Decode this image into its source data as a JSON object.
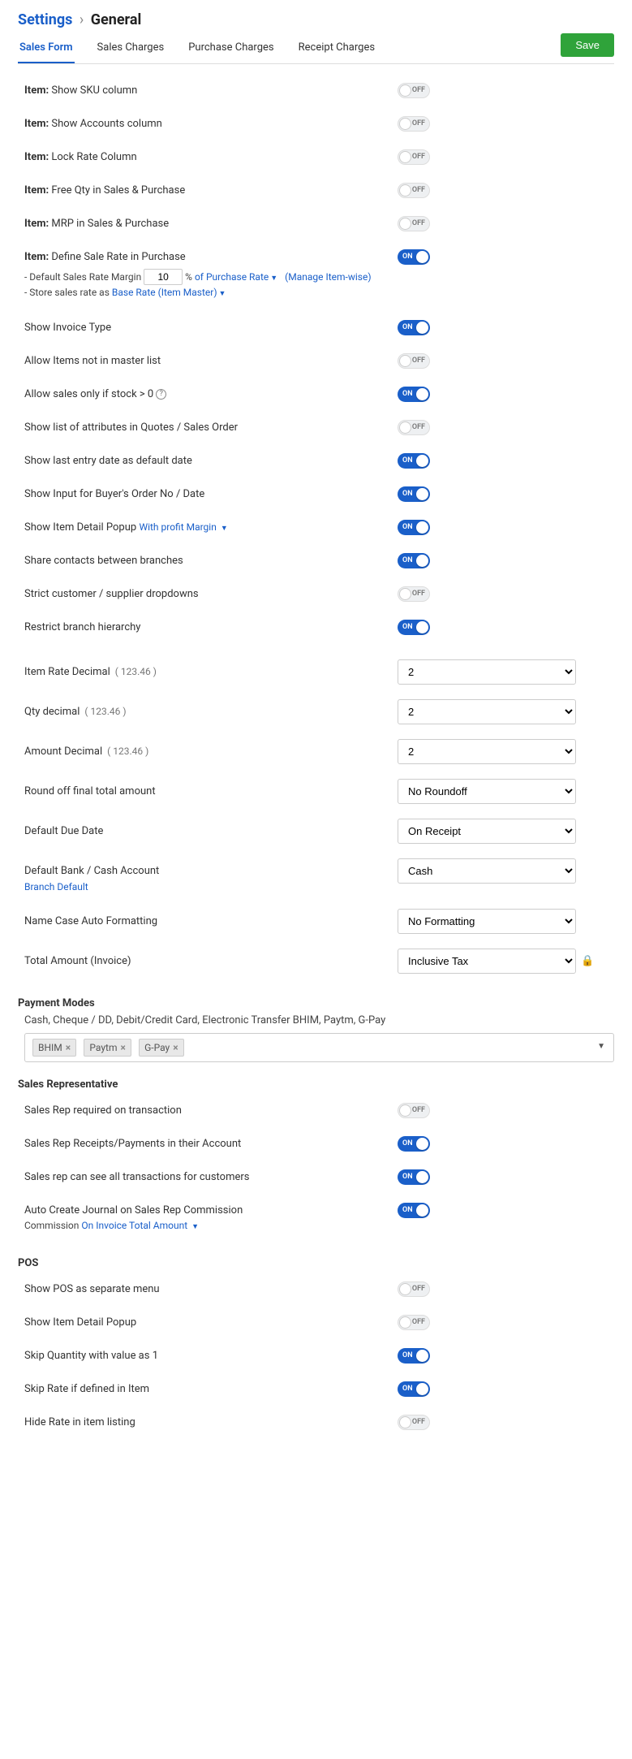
{
  "breadcrumb": {
    "parent": "Settings",
    "sep": "›",
    "current": "General"
  },
  "tabs": {
    "t0": "Sales Form",
    "t1": "Sales Charges",
    "t2": "Purchase Charges",
    "t3": "Receipt Charges"
  },
  "save": "Save",
  "item_prefix": "Item:",
  "toggles": {
    "sku": {
      "label": "Show SKU column",
      "state": "OFF"
    },
    "accounts": {
      "label": "Show Accounts column",
      "state": "OFF"
    },
    "lockrate": {
      "label": "Lock Rate Column",
      "state": "OFF"
    },
    "freeqty": {
      "label": "Free Qty in Sales & Purchase",
      "state": "OFF"
    },
    "mrp": {
      "label": "MRP in Sales & Purchase",
      "state": "OFF"
    },
    "defsale": {
      "label": "Define Sale Rate in Purchase",
      "state": "ON"
    },
    "invtype": {
      "label": "Show Invoice Type",
      "state": "ON"
    },
    "notmaster": {
      "label": "Allow Items not in master list",
      "state": "OFF"
    },
    "stockgt0": {
      "label": "Allow sales only if stock > 0",
      "state": "ON"
    },
    "attrlist": {
      "label": "Show list of attributes in Quotes / Sales Order",
      "state": "OFF"
    },
    "lastdate": {
      "label": "Show last entry date as default date",
      "state": "ON"
    },
    "buyerord": {
      "label": "Show Input for Buyer's Order No / Date",
      "state": "ON"
    },
    "itempopup": {
      "label": "Show Item Detail Popup",
      "state": "ON"
    },
    "sharecont": {
      "label": "Share contacts between branches",
      "state": "ON"
    },
    "strictdd": {
      "label": "Strict customer / supplier dropdowns",
      "state": "OFF"
    },
    "branchhier": {
      "label": "Restrict branch hierarchy",
      "state": "ON"
    },
    "srreq": {
      "label": "Sales Rep required on transaction",
      "state": "OFF"
    },
    "srrcpt": {
      "label": "Sales Rep Receipts/Payments in their Account",
      "state": "ON"
    },
    "sralltx": {
      "label": "Sales rep can see all transactions for customers",
      "state": "ON"
    },
    "srjournal": {
      "label": "Auto Create Journal on Sales Rep Commission",
      "state": "ON"
    },
    "posmenu": {
      "label": "Show POS as separate menu",
      "state": "OFF"
    },
    "posdetail": {
      "label": "Show Item Detail Popup",
      "state": "OFF"
    },
    "posskipqty": {
      "label": "Skip Quantity with value as 1",
      "state": "ON"
    },
    "posskiprate": {
      "label": "Skip Rate if defined in Item",
      "state": "ON"
    },
    "poshiderate": {
      "label": "Hide Rate in item listing",
      "state": "OFF"
    }
  },
  "defsale_sub": {
    "line1_pre": "- Default Sales Rate Margin",
    "margin_value": "10",
    "pct": "%",
    "of_purchase": "of Purchase Rate",
    "manage": "(Manage Item-wise)",
    "line2_pre": "- Store sales rate as",
    "baserate": "Base Rate (Item Master)"
  },
  "popup_link": "With profit Margin",
  "selects": {
    "rate_dec": {
      "label": "Item Rate Decimal",
      "example": "( 123.46 )",
      "value": "2"
    },
    "qty_dec": {
      "label": "Qty decimal",
      "example": "( 123.46 )",
      "value": "2"
    },
    "amt_dec": {
      "label": "Amount Decimal",
      "example": "( 123.46 )",
      "value": "2"
    },
    "round": {
      "label": "Round off final total amount",
      "value": "No Roundoff"
    },
    "duedate": {
      "label": "Default Due Date",
      "value": "On Receipt"
    },
    "bank": {
      "label": "Default Bank / Cash Account",
      "sub": "Branch Default",
      "value": "Cash"
    },
    "namecase": {
      "label": "Name Case Auto Formatting",
      "value": "No Formatting"
    },
    "total": {
      "label": "Total Amount (Invoice)",
      "value": "Inclusive Tax"
    }
  },
  "sections": {
    "payment": "Payment Modes",
    "payment_note": "Cash, Cheque / DD, Debit/Credit Card, Electronic Transfer BHIM, Paytm, G-Pay",
    "salesrep": "Sales Representative",
    "pos": "POS"
  },
  "tags": {
    "t0": "BHIM",
    "t1": "Paytm",
    "t2": "G-Pay",
    "x": "×"
  },
  "srjournal_sub": {
    "pre": "Commission",
    "link": "On Invoice Total Amount"
  }
}
